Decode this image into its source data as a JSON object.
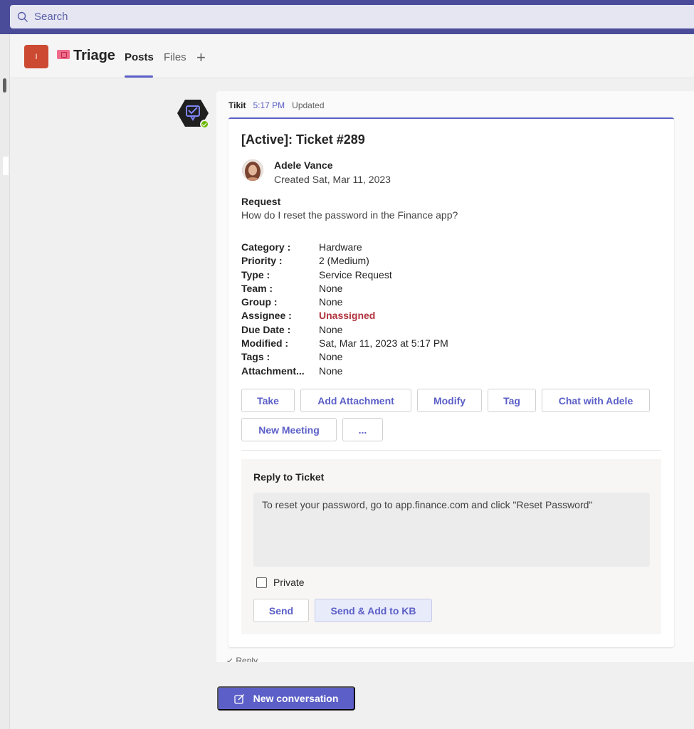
{
  "search": {
    "placeholder": "Search",
    "icon": "search-icon"
  },
  "header": {
    "team_initial": "I",
    "team_color": "#cc4a31",
    "channel_name": "Triage",
    "tabs": [
      {
        "label": "Posts",
        "active": true
      },
      {
        "label": "Files",
        "active": false
      }
    ],
    "add_tab_icon": "plus-icon"
  },
  "message": {
    "sender": "Tikit",
    "time": "5:17 PM",
    "status": "Updated",
    "card": {
      "title": "[Active]: Ticket #289",
      "requester_name": "Adele Vance",
      "created": "Created Sat, Mar 11, 2023",
      "request_label": "Request",
      "request_text": "How do I reset the password in the Finance app?",
      "facts": [
        {
          "key": "Category :",
          "value": "Hardware"
        },
        {
          "key": "Priority :",
          "value": "2 (Medium)"
        },
        {
          "key": "Type :",
          "value": "Service Request"
        },
        {
          "key": "Team :",
          "value": "None"
        },
        {
          "key": "Group :",
          "value": "None"
        },
        {
          "key": "Assignee :",
          "value": "Unassigned",
          "highlight": true
        },
        {
          "key": "Due Date :",
          "value": "None"
        },
        {
          "key": "Modified :",
          "value": "Sat, Mar 11, 2023 at 5:17 PM"
        },
        {
          "key": "Tags :",
          "value": "None"
        },
        {
          "key": "Attachment...",
          "value": "None"
        }
      ],
      "actions": [
        "Take",
        "Add Attachment",
        "Modify",
        "Tag",
        "Chat with Adele",
        "New Meeting",
        "..."
      ],
      "reply": {
        "title": "Reply to Ticket",
        "input_value": "To reset your password, go to app.finance.com and click \"Reset Password\"",
        "private_label": "Private",
        "send_label": "Send",
        "send_kb_label": "Send & Add to KB"
      }
    },
    "reply_link": "Reply"
  },
  "new_conversation_label": "New conversation",
  "colors": {
    "accent": "#5b5fc7",
    "topbar": "#4b4c99",
    "unassigned": "#b1333d"
  }
}
